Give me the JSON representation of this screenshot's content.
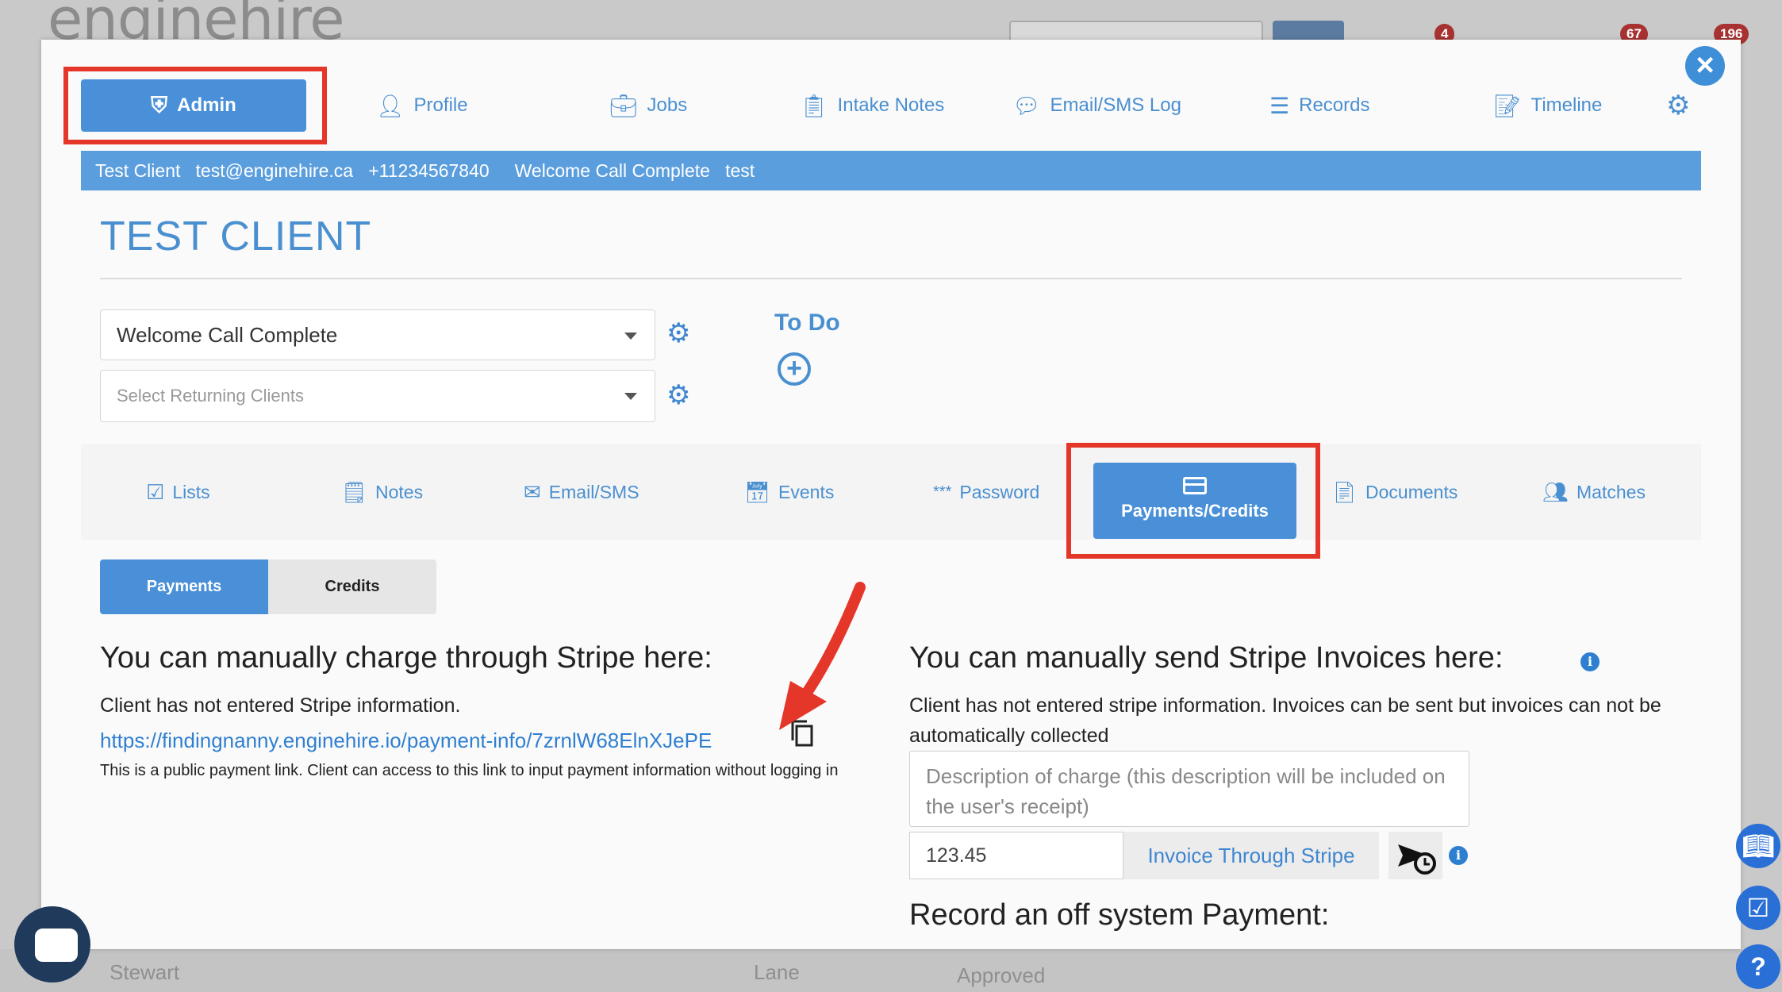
{
  "background": {
    "logo_text": "enginehire",
    "badges": [
      "4",
      "67",
      "196"
    ],
    "bottom_row": [
      "Stewart",
      "Lane",
      "Approved"
    ]
  },
  "topnav": {
    "admin": "Admin",
    "items": [
      "Profile",
      "Jobs",
      "Intake Notes",
      "Email/SMS Log",
      "Records",
      "Timeline"
    ]
  },
  "infobar": {
    "name": "Test Client",
    "email": "test@enginehire.ca",
    "phone": "+11234567840",
    "status": "Welcome Call Complete",
    "note": "test"
  },
  "page_title": "TEST CLIENT",
  "status_select": {
    "value": "Welcome Call Complete"
  },
  "returning_select": {
    "placeholder": "Select Returning Clients"
  },
  "todo": {
    "title": "To Do"
  },
  "subnav": {
    "tabs": [
      "Lists",
      "Notes",
      "Email/SMS",
      "Events",
      "Password",
      "Payments/Credits",
      "Documents",
      "Matches"
    ]
  },
  "toggle": {
    "payments": "Payments",
    "credits": "Credits"
  },
  "manual_charge": {
    "heading": "You can manually charge through Stripe here:",
    "status": "Client has not entered Stripe information.",
    "link": "https://findingnanny.enginehire.io/payment-info/7zrnlW68ElnXJePE",
    "note": "This is a public payment link. Client can access to this link to input payment information without logging in"
  },
  "invoices": {
    "heading": "You can manually send Stripe Invoices here:",
    "status": "Client has not entered stripe information. Invoices can be sent but invoices can not be automatically collected",
    "description_placeholder": "Description of charge (this description will be included on the user's receipt)",
    "amount_placeholder": "123.45",
    "invoice_button": "Invoice Through Stripe"
  },
  "off_system": {
    "heading": "Record an off system Payment:"
  },
  "colors": {
    "primary": "#4a90d9",
    "highlight": "#e5362a",
    "infobar": "#5b9ede"
  }
}
